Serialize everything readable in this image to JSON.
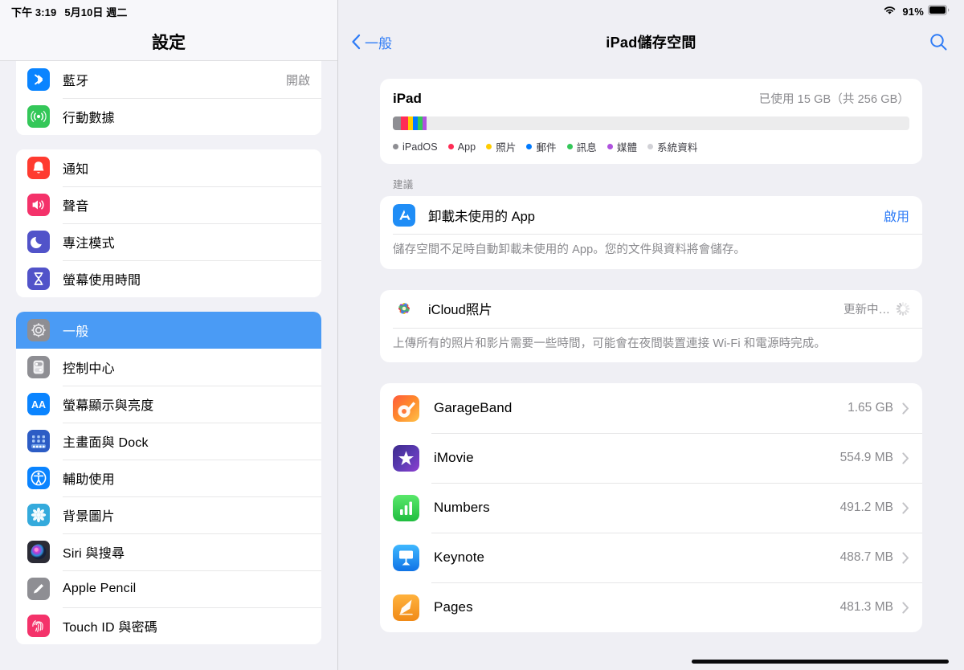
{
  "statusbar": {
    "time": "下午 3:19",
    "date": "5月10日 週二",
    "wifi_icon": "wifi-icon",
    "battery_percent": "91%",
    "battery_icon": "battery-icon"
  },
  "sidebar": {
    "title": "設定",
    "groups": [
      {
        "items": [
          {
            "label": "藍牙",
            "value": "開啟",
            "icon": "bluetooth-icon",
            "color": "#0a84ff",
            "selected": false
          },
          {
            "label": "行動數據",
            "value": "",
            "icon": "cellular-icon",
            "color": "#34c759",
            "selected": false
          }
        ]
      },
      {
        "items": [
          {
            "label": "通知",
            "value": "",
            "icon": "bell-icon",
            "color": "#ff3b30",
            "selected": false
          },
          {
            "label": "聲音",
            "value": "",
            "icon": "speaker-icon",
            "color": "#f4326a",
            "selected": false
          },
          {
            "label": "專注模式",
            "value": "",
            "icon": "moon-icon",
            "color": "#5153c9",
            "selected": false
          },
          {
            "label": "螢幕使用時間",
            "value": "",
            "icon": "hourglass-icon",
            "color": "#5153c9",
            "selected": false
          }
        ]
      },
      {
        "items": [
          {
            "label": "一般",
            "value": "",
            "icon": "gear-icon",
            "color": "#8e8e93",
            "selected": true
          },
          {
            "label": "控制中心",
            "value": "",
            "icon": "toggles-icon",
            "color": "#8e8e93",
            "selected": false
          },
          {
            "label": "螢幕顯示與亮度",
            "value": "",
            "icon": "text-size-icon",
            "color": "#0a84ff",
            "selected": false
          },
          {
            "label": "主畫面與 Dock",
            "value": "",
            "icon": "home-screen-icon",
            "color": "#2c5cc5",
            "selected": false
          },
          {
            "label": "輔助使用",
            "value": "",
            "icon": "accessibility-icon",
            "color": "#0a84ff",
            "selected": false
          },
          {
            "label": "背景圖片",
            "value": "",
            "icon": "wallpaper-icon",
            "color": "#34aadc",
            "selected": false
          },
          {
            "label": "Siri 與搜尋",
            "value": "",
            "icon": "siri-icon",
            "color": "#2b2b35",
            "selected": false
          },
          {
            "label": "Apple Pencil",
            "value": "",
            "icon": "pencil-icon",
            "color": "#8e8e93",
            "selected": false
          },
          {
            "label": "Touch ID 與密碼",
            "value": "",
            "icon": "fingerprint-icon",
            "color": "#f4326a",
            "selected": false
          }
        ]
      }
    ]
  },
  "detail": {
    "back_label": "一般",
    "back_icon": "chevron-left-icon",
    "title": "iPad儲存空間",
    "search_icon": "search-icon",
    "usage": {
      "device_name": "iPad",
      "capacity_text": "已使用 15 GB（共 256 GB）",
      "legend": [
        {
          "label": "iPadOS",
          "color": "#8e8e93"
        },
        {
          "label": "App",
          "color": "#ff2d55"
        },
        {
          "label": "照片",
          "color": "#ffcc00"
        },
        {
          "label": "郵件",
          "color": "#007aff"
        },
        {
          "label": "訊息",
          "color": "#34c759"
        },
        {
          "label": "媒體",
          "color": "#af52de"
        },
        {
          "label": "系統資料",
          "color": "#d1d1d6"
        }
      ]
    },
    "recommendation_section_title": "建議",
    "recommendation": {
      "label": "卸載未使用的 App",
      "action": "啟用",
      "icon": "app-store-icon",
      "description": "儲存空間不足時自動卸載未使用的 App。您的文件與資料將會儲存。"
    },
    "icloud_photos": {
      "label": "iCloud照片",
      "status": "更新中…",
      "icon": "photos-icon",
      "spinner_icon": "activity-spinner-icon",
      "description": "上傳所有的照片和影片需要一些時間，可能會在夜間裝置連接 Wi-Fi 和電源時完成。"
    },
    "apps": [
      {
        "name": "GarageBand",
        "size": "1.65 GB",
        "icon": "garageband-icon"
      },
      {
        "name": "iMovie",
        "size": "554.9 MB",
        "icon": "imovie-icon"
      },
      {
        "name": "Numbers",
        "size": "491.2 MB",
        "icon": "numbers-icon"
      },
      {
        "name": "Keynote",
        "size": "488.7 MB",
        "icon": "keynote-icon"
      },
      {
        "name": "Pages",
        "size": "481.3 MB",
        "icon": "pages-icon"
      }
    ],
    "chevron_icon": "chevron-right-icon"
  },
  "chart_data": {
    "type": "bar",
    "title": "iPad 儲存空間使用量",
    "orientation": "stacked-horizontal",
    "total_gb": 256,
    "used_gb": 15,
    "categories": [
      "iPadOS",
      "App",
      "照片",
      "郵件",
      "訊息",
      "媒體",
      "系統資料"
    ],
    "colors": [
      "#8e8e93",
      "#ff2d55",
      "#ffcc00",
      "#007aff",
      "#34c759",
      "#af52de",
      "#d1d1d6"
    ],
    "values_percent_of_total": [
      1.6,
      1.4,
      0.9,
      0.9,
      0.9,
      0.9,
      0.0
    ],
    "xlabel": "",
    "ylabel": "",
    "grid": false,
    "legend_position": "bottom"
  }
}
